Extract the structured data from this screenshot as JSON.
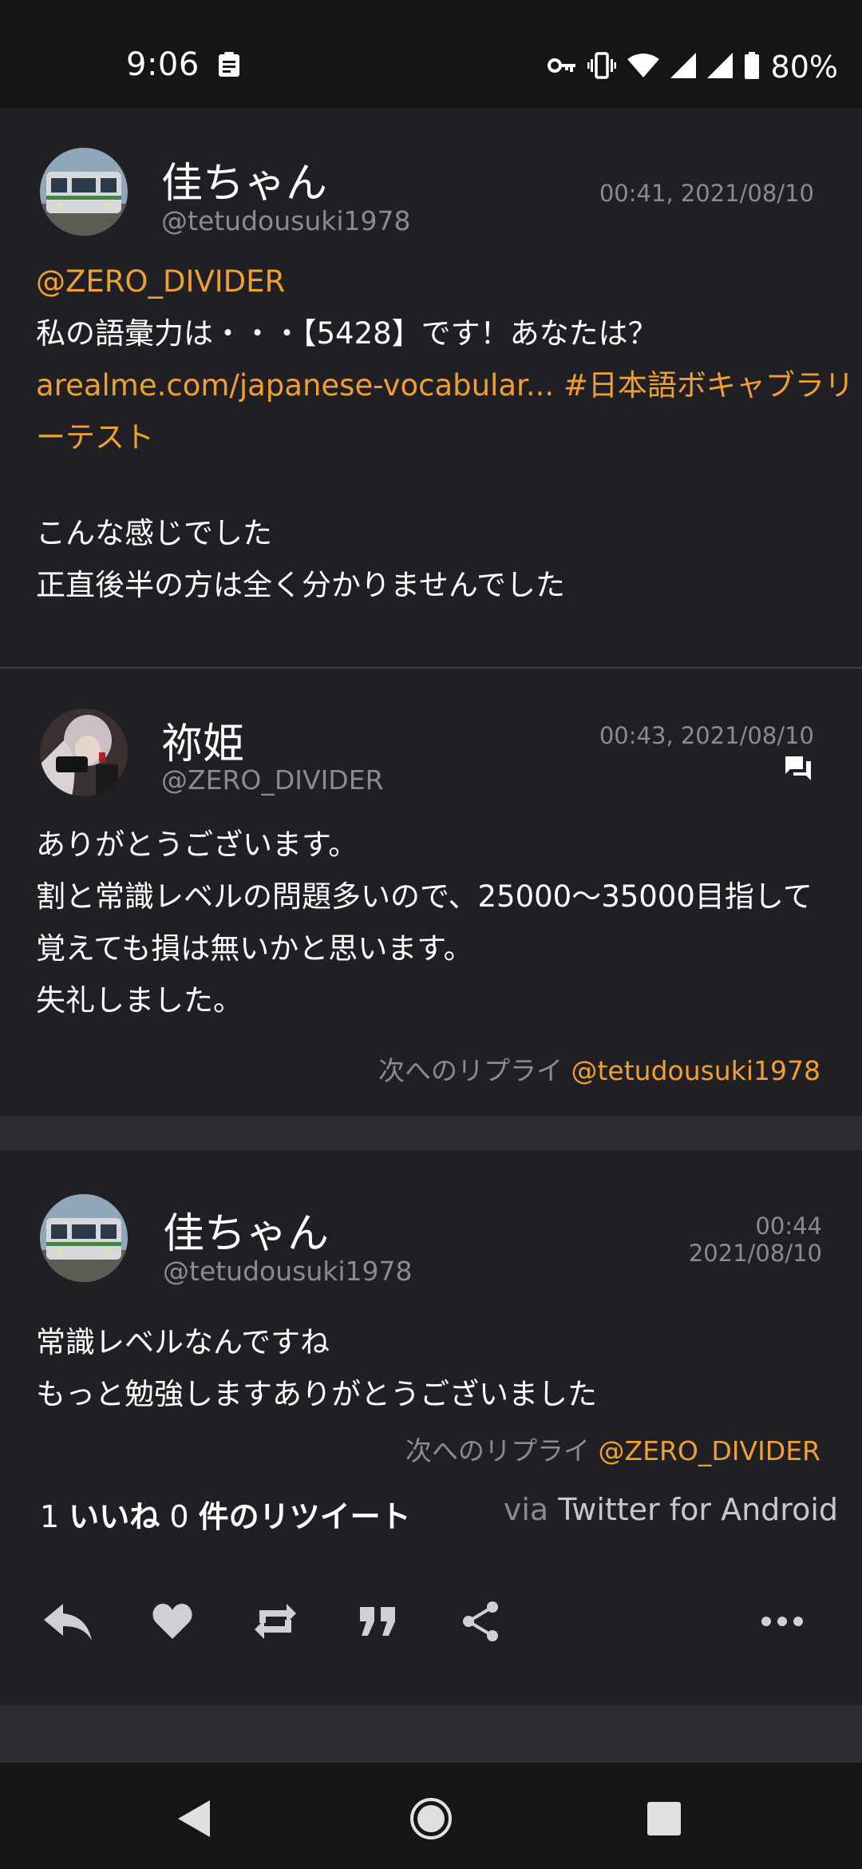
{
  "status_bar": {
    "time": "9:06",
    "battery": "80%",
    "icons": [
      "clipboard-icon",
      "vpn-key-icon",
      "vibrate-icon",
      "wifi-icon",
      "signal-icon",
      "signal-icon",
      "battery-icon"
    ]
  },
  "tweets": [
    {
      "name": "佳ちゃん",
      "handle": "@tetudousuki1978",
      "time": "00:41, 2021/08/10",
      "mention": "@ZERO_DIVIDER",
      "line1": "私の語彙力は・・・【5428】です！あなたは？",
      "link": "arealme.com/japanese-vocabular...",
      "hashtag_part1": "#日本語ボキャブラリ",
      "hashtag_part2": "ーテスト",
      "line3": "こんな感じでした",
      "line4": "正直後半の方は全く分かりませんでした"
    },
    {
      "name": "祢姫",
      "handle": "@ZERO_DIVIDER",
      "time": "00:43, 2021/08/10",
      "line1": "ありがとうございます。",
      "line2": "割と常識レベルの問題多いので、25000〜35000目指して",
      "line3": "覚えても損は無いかと思います。",
      "line4": "失礼しました。",
      "reply_prefix": "次へのリプライ",
      "reply_handle": "@tetudousuki1978"
    },
    {
      "name": "佳ちゃん",
      "handle": "@tetudousuki1978",
      "time_line1": "00:44",
      "time_line2": "2021/08/10",
      "line1": "常識レベルなんですね",
      "line2": "もっと勉強しますありがとうございました",
      "reply_prefix": "次へのリプライ",
      "reply_handle": "@ZERO_DIVIDER",
      "likes_count": "1",
      "likes_label": "いいね",
      "retweets_count": "0",
      "retweets_label": "件のリツイート",
      "via_prefix": "via",
      "via_app": "Twitter for Android"
    }
  ],
  "actions": [
    "reply-icon",
    "like-icon",
    "retweet-icon",
    "quote-icon",
    "share-icon",
    "more-icon"
  ],
  "nav": [
    "back-icon",
    "home-icon",
    "recents-icon"
  ],
  "colors": {
    "accent": "#f0a030",
    "background": "#202024",
    "status_bar": "#151517",
    "muted_text": "#8a8a90"
  }
}
